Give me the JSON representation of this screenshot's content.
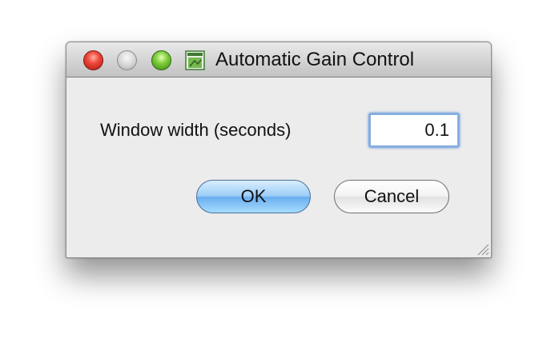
{
  "window": {
    "title": "Automatic Gain Control",
    "app_icon": "app-window-icon"
  },
  "form": {
    "width_label": "Window width (seconds)",
    "width_value": "0.1"
  },
  "buttons": {
    "ok_label": "OK",
    "cancel_label": "Cancel"
  },
  "colors": {
    "close": "#e4392c",
    "minimize": "#c8c8c8",
    "zoom": "#6bbf2f",
    "default_button": "#8ec6f5",
    "focus_ring": "#86aee0"
  }
}
